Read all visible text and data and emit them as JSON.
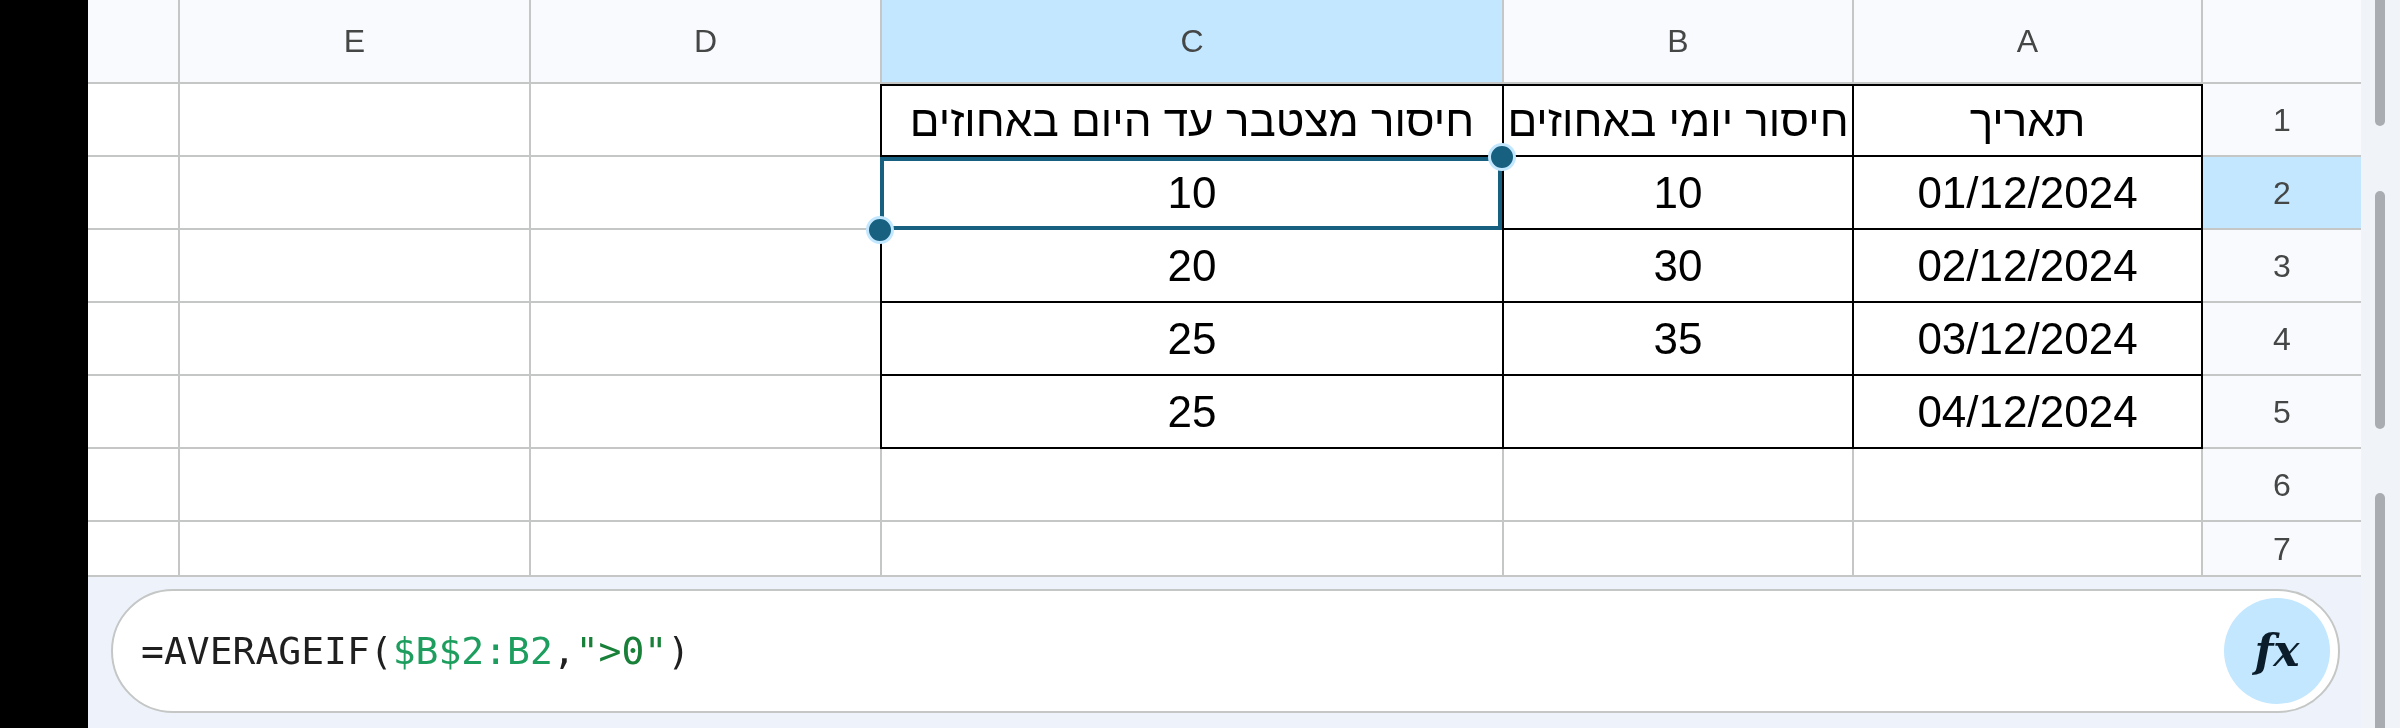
{
  "sheet": {
    "columns": [
      {
        "label": "E",
        "selected": false
      },
      {
        "label": "D",
        "selected": false
      },
      {
        "label": "C",
        "selected": true
      },
      {
        "label": "B",
        "selected": false
      },
      {
        "label": "A",
        "selected": false
      }
    ],
    "rows": [
      {
        "number": "1",
        "selected": false,
        "cells": {
          "c": {
            "text": "חיסור מצטבר עד היום באחוזים",
            "bordered": true,
            "selected": false
          },
          "b": {
            "text": "חיסור יומי באחוזים",
            "bordered": true,
            "selected": false
          },
          "a": {
            "text": "תאריך",
            "bordered": true,
            "selected": false
          }
        }
      },
      {
        "number": "2",
        "selected": true,
        "cells": {
          "c": {
            "text": "10",
            "bordered": true,
            "selected": true
          },
          "b": {
            "text": "10",
            "bordered": true,
            "selected": false
          },
          "a": {
            "text": "01/12/2024",
            "bordered": true,
            "selected": false
          }
        }
      },
      {
        "number": "3",
        "selected": false,
        "cells": {
          "c": {
            "text": "20",
            "bordered": true,
            "selected": false
          },
          "b": {
            "text": "30",
            "bordered": true,
            "selected": false
          },
          "a": {
            "text": "02/12/2024",
            "bordered": true,
            "selected": false
          }
        }
      },
      {
        "number": "4",
        "selected": false,
        "cells": {
          "c": {
            "text": "25",
            "bordered": true,
            "selected": false
          },
          "b": {
            "text": "35",
            "bordered": true,
            "selected": false
          },
          "a": {
            "text": "03/12/2024",
            "bordered": true,
            "selected": false
          }
        }
      },
      {
        "number": "5",
        "selected": false,
        "cells": {
          "c": {
            "text": "25",
            "bordered": true,
            "selected": false
          },
          "b": {
            "bordered": true,
            "selected": false
          },
          "a": {
            "text": "04/12/2024",
            "bordered": true,
            "selected": false
          }
        }
      },
      {
        "number": "6",
        "selected": false
      },
      {
        "number": "7",
        "selected": false
      }
    ]
  },
  "formula_bar": {
    "tokens": [
      {
        "kind": "plain",
        "text": "=AVERAGEIF("
      },
      {
        "kind": "range",
        "text": "$B$2:B2"
      },
      {
        "kind": "plain",
        "text": ","
      },
      {
        "kind": "string",
        "text": "\">0\""
      },
      {
        "kind": "plain",
        "text": ")"
      }
    ],
    "function_button": "fx"
  }
}
